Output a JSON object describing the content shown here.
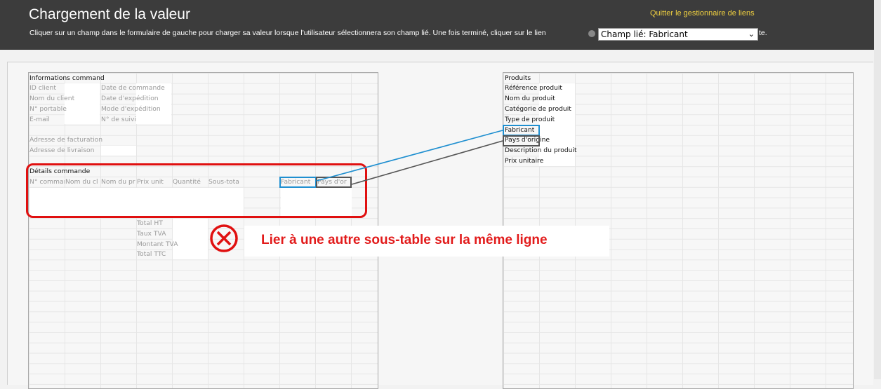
{
  "header": {
    "title": "Chargement de la valeur",
    "subtitle": "Cliquer sur un champ dans le formulaire de gauche pour charger sa valeur lorsque l'utilisateur sélectionnera son champ lié. Une fois terminé, cliquer sur le lien",
    "subtitle_end": "te.",
    "quit_label": "Quitter le gestionnaire de liens",
    "linked_field_select": "Champ lié: Fabricant"
  },
  "left_form": {
    "section_title": "Informations command",
    "fields": [
      "ID client",
      "Date de commande",
      "Nom du client",
      "Date d'expédition",
      "N° portable",
      "Mode d'expédition",
      "E-mail",
      "N° de suivi",
      "Adresse de facturation",
      "Adresse de livraison"
    ],
    "details_title": "Détails commande",
    "columns": [
      "N° commar",
      "Nom du cl",
      "Nom du pr",
      "Prix unit",
      "Quantité",
      "Sous-tota",
      "Fabricant",
      "Pays d'or"
    ],
    "totals": [
      "Total HT",
      "Taux TVA",
      "Montant TVA",
      "Total TTC"
    ]
  },
  "right_form": {
    "section_title": "Produits",
    "fields": [
      "Référence produit",
      "Nom du produit",
      "Catégorie de produit",
      "Type de produit",
      "Fabricant",
      "Pays d'origine",
      "Description du produit",
      "Prix unitaire"
    ]
  },
  "callout": {
    "message": "Lier à une autre sous-table sur la même ligne"
  },
  "colors": {
    "error_red": "#e01010",
    "link_blue": "#1f8fd0",
    "link_dark": "#555555",
    "header_bg": "#3c3c3c",
    "quit_link": "#f0d040"
  }
}
